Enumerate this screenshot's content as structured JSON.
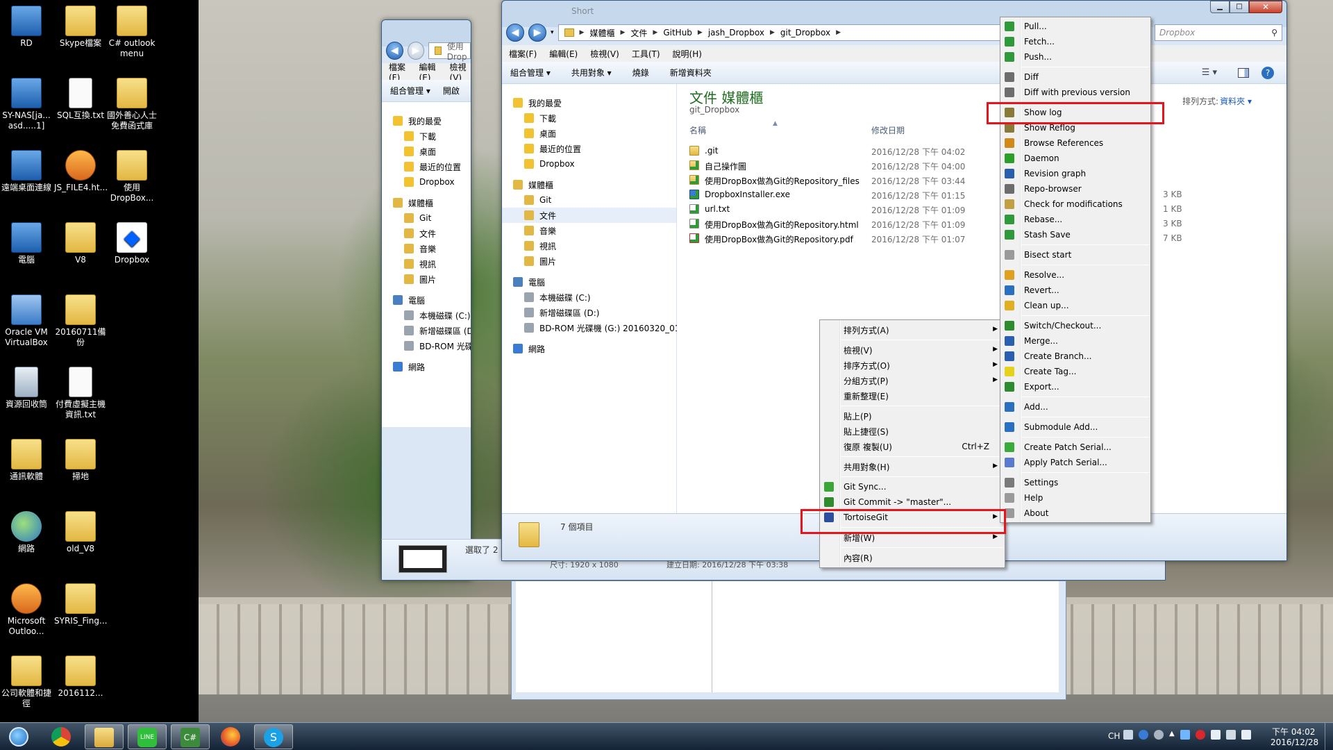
{
  "desktop": {
    "icons": [
      {
        "label": "RD"
      },
      {
        "label": "Skype檔案"
      },
      {
        "label": "C# outlook menu"
      },
      {
        "label": "SY-NAS[ja... asd.....1]"
      },
      {
        "label": "SQL互換.txt"
      },
      {
        "label": "國外善心人士免費函式庫"
      },
      {
        "label": "遠端桌面連線"
      },
      {
        "label": "JS_FILE4.ht..."
      },
      {
        "label": "使用DropBox..."
      },
      {
        "label": "電腦"
      },
      {
        "label": "V8"
      },
      {
        "label": "Dropbox"
      },
      {
        "label": "Oracle VM VirtualBox"
      },
      {
        "label": "20160711備份"
      },
      {
        "label": "資源回收筒"
      },
      {
        "label": "付費虛擬主機資訊.txt"
      },
      {
        "label": "通訊軟體"
      },
      {
        "label": "掃地"
      },
      {
        "label": "網路"
      },
      {
        "label": "old_V8"
      },
      {
        "label": "Microsoft Outloo..."
      },
      {
        "label": "SYRIS_Fing..."
      },
      {
        "label": "公司軟體和捷徑"
      },
      {
        "label": "2016112..."
      }
    ]
  },
  "back_window": {
    "address": "使用Drop",
    "menu": [
      "檔案(F)",
      "編輯(E)",
      "檢視(V)"
    ],
    "toolbar": [
      "組合管理 ▾",
      "開啟"
    ],
    "nav": {
      "favorites": "我的最愛",
      "fav_items": [
        "下載",
        "桌面",
        "最近的位置",
        "Dropbox"
      ],
      "libraries": "媒體櫃",
      "lib_items": [
        "Git",
        "文件",
        "音樂",
        "視訊",
        "圖片"
      ],
      "computer": "電腦",
      "comp_items": [
        "本機磁碟 (C:)",
        "新增磁碟區 (D:)",
        "BD-ROM 光碟機 (G:)"
      ],
      "network": "網路"
    },
    "status": "選取了 2",
    "status2": "尺寸: 1920 x 1080",
    "status3": "建立日期: 2016/12/28 下午 03:38"
  },
  "main_window": {
    "title": "Short",
    "breadcrumbs": [
      "媒體櫃",
      "文件",
      "GitHub",
      "jash_Dropbox",
      "git_Dropbox"
    ],
    "search_placeholder": "Dropbox",
    "menu": [
      "檔案(F)",
      "編輯(E)",
      "檢視(V)",
      "工具(T)",
      "說明(H)"
    ],
    "toolbar": [
      "組合管理 ▾",
      "共用對象 ▾",
      "燒錄",
      "新增資料夾"
    ],
    "nav": {
      "favorites": "我的最愛",
      "fav_items": [
        "下載",
        "桌面",
        "最近的位置",
        "Dropbox"
      ],
      "libraries": "媒體櫃",
      "lib_items": [
        "Git",
        "文件",
        "音樂",
        "視訊",
        "圖片"
      ],
      "computer": "電腦",
      "comp_items": [
        "本機磁碟 (C:)",
        "新增磁碟區 (D:)",
        "BD-ROM 光碟機 (G:) 20160320_01"
      ],
      "network": "網路"
    },
    "library_title": "文件 媒體櫃",
    "library_subtitle": "git_Dropbox",
    "arrange_label": "排列方式:",
    "arrange_value": "資料夾 ▾",
    "columns": {
      "name": "名稱",
      "modified": "修改日期"
    },
    "files": [
      {
        "name": ".git",
        "date": "2016/12/28 下午 04:02",
        "size": ""
      },
      {
        "name": "自己操作圖",
        "date": "2016/12/28 下午 04:00",
        "size": ""
      },
      {
        "name": "使用DropBox做為Git的Repository_files",
        "date": "2016/12/28 下午 03:44",
        "size": ""
      },
      {
        "name": "DropboxInstaller.exe",
        "date": "2016/12/28 下午 01:15",
        "size": "3 KB"
      },
      {
        "name": "url.txt",
        "date": "2016/12/28 下午 01:09",
        "size": "1 KB"
      },
      {
        "name": "使用DropBox做為Git的Repository.html",
        "date": "2016/12/28 下午 01:09",
        "size": "3 KB"
      },
      {
        "name": "使用DropBox做為Git的Repository.pdf",
        "date": "2016/12/28 下午 01:07",
        "size": "7 KB"
      }
    ],
    "item_count": "7 個項目"
  },
  "context_menu": {
    "items": [
      {
        "label": "排列方式(A)",
        "sub": "▶"
      },
      {
        "sep": true
      },
      {
        "label": "檢視(V)",
        "sub": "▶"
      },
      {
        "label": "排序方式(O)",
        "sub": "▶"
      },
      {
        "label": "分組方式(P)",
        "sub": "▶"
      },
      {
        "label": "重新整理(E)"
      },
      {
        "sep": true
      },
      {
        "label": "貼上(P)"
      },
      {
        "label": "貼上捷徑(S)"
      },
      {
        "label": "復原 複製(U)",
        "accel": "Ctrl+Z"
      },
      {
        "sep": true
      },
      {
        "label": "共用對象(H)",
        "sub": "▶"
      },
      {
        "sep": true
      },
      {
        "label": "Git Sync...",
        "icon": "git-sync-icon",
        "color": "#3aa635"
      },
      {
        "label": "Git Commit -> \"master\"...",
        "icon": "git-commit-icon",
        "color": "#2e8b2e"
      },
      {
        "label": "TortoiseGit",
        "sub": "▶",
        "icon": "tortoisegit-icon",
        "color": "#2b4f9e"
      },
      {
        "sep": true
      },
      {
        "label": "新增(W)",
        "sub": "▶"
      },
      {
        "sep": true
      },
      {
        "label": "內容(R)"
      }
    ]
  },
  "tortoise_menu": {
    "items": [
      {
        "label": "Pull...",
        "icon": "pull-icon",
        "color": "#2e9a3a"
      },
      {
        "label": "Fetch...",
        "icon": "fetch-icon",
        "color": "#2e9a3a"
      },
      {
        "label": "Push...",
        "icon": "push-icon",
        "color": "#2e9a3a"
      },
      {
        "sep": true
      },
      {
        "label": "Diff",
        "icon": "diff-icon",
        "color": "#6d6d6d"
      },
      {
        "label": "Diff with previous version",
        "icon": "diff-prev-icon",
        "color": "#6d6d6d"
      },
      {
        "sep": true
      },
      {
        "label": "Show log",
        "icon": "show-log-icon",
        "color": "#8a7a3a"
      },
      {
        "label": "Show Reflog",
        "icon": "show-reflog-icon",
        "color": "#8a7a3a"
      },
      {
        "label": "Browse References",
        "icon": "browse-references-icon",
        "color": "#d08a1a"
      },
      {
        "label": "Daemon",
        "icon": "daemon-icon",
        "color": "#2aa02a"
      },
      {
        "label": "Revision graph",
        "icon": "revision-graph-icon",
        "color": "#2a5fb0"
      },
      {
        "label": "Repo-browser",
        "icon": "repo-browser-icon",
        "color": "#6d6d6d"
      },
      {
        "label": "Check for modifications",
        "icon": "check-modifications-icon",
        "color": "#c0a040"
      },
      {
        "label": "Rebase...",
        "icon": "rebase-icon",
        "color": "#2e9a3a"
      },
      {
        "label": "Stash Save",
        "icon": "stash-save-icon",
        "color": "#2e9a3a"
      },
      {
        "sep": true
      },
      {
        "label": "Bisect start",
        "icon": "bisect-icon",
        "color": "#9a9a9a"
      },
      {
        "sep": true
      },
      {
        "label": "Resolve...",
        "icon": "resolve-icon",
        "color": "#e0a020"
      },
      {
        "label": "Revert...",
        "icon": "revert-icon",
        "color": "#2a6fc0"
      },
      {
        "label": "Clean up...",
        "icon": "cleanup-icon",
        "color": "#e0b020"
      },
      {
        "sep": true
      },
      {
        "label": "Switch/Checkout...",
        "icon": "switch-icon",
        "color": "#2e8b2e"
      },
      {
        "label": "Merge...",
        "icon": "merge-icon",
        "color": "#2a5fb0"
      },
      {
        "label": "Create Branch...",
        "icon": "branch-icon",
        "color": "#2a5fb0"
      },
      {
        "label": "Create Tag...",
        "icon": "tag-icon",
        "color": "#e6d21a"
      },
      {
        "label": "Export...",
        "icon": "export-icon",
        "color": "#2e8b2e"
      },
      {
        "sep": true
      },
      {
        "label": "Add...",
        "icon": "add-icon",
        "color": "#2a6fc0"
      },
      {
        "sep": true
      },
      {
        "label": "Submodule Add...",
        "icon": "submodule-add-icon",
        "color": "#2a6fc0"
      },
      {
        "sep": true
      },
      {
        "label": "Create Patch Serial...",
        "icon": "create-patch-icon",
        "color": "#3aaa3a"
      },
      {
        "label": "Apply Patch Serial...",
        "icon": "apply-patch-icon",
        "color": "#5a7ad0"
      },
      {
        "sep": true
      },
      {
        "label": "Settings",
        "icon": "settings-icon",
        "color": "#7a7a7a"
      },
      {
        "label": "Help",
        "icon": "help-icon",
        "color": "#9a9a9a"
      },
      {
        "label": "About",
        "icon": "about-icon",
        "color": "#9a9a9a"
      }
    ]
  },
  "highlight_color": "#e8131b",
  "taskbar": {
    "apps": [
      "start-button",
      "chrome-icon",
      "explorer-icon",
      "line-icon",
      "csharp-icon",
      "firefox-icon",
      "skype-icon"
    ],
    "lang": "CH",
    "time": "下午 04:02",
    "date": "2016/12/28"
  }
}
